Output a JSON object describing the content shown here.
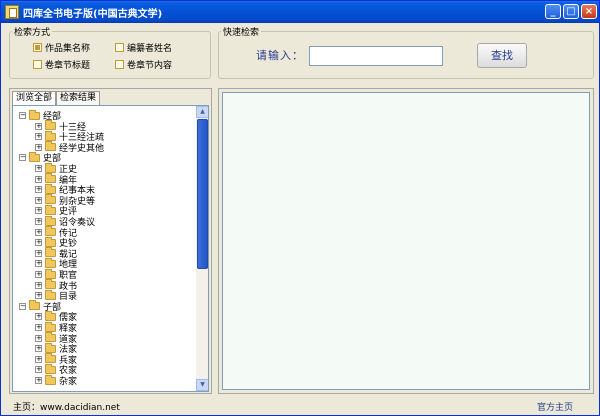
{
  "window": {
    "title": "四库全书电子版(中国古典文学)"
  },
  "search_method": {
    "legend": "检索方式",
    "options": [
      {
        "label": "作品集名称",
        "checked": true
      },
      {
        "label": "编纂者姓名",
        "checked": false
      },
      {
        "label": "卷章节标题",
        "checked": false
      },
      {
        "label": "卷章节内容",
        "checked": false
      }
    ]
  },
  "quick_search": {
    "legend": "快速检索",
    "prompt": "请输入：",
    "input_value": "",
    "button": "查找"
  },
  "tabs": [
    "浏览全部",
    "检索结果"
  ],
  "tree": [
    {
      "label": "经部",
      "level": 0,
      "sign": "−"
    },
    {
      "label": "十三经",
      "level": 1,
      "sign": "+"
    },
    {
      "label": "十三经注疏",
      "level": 1,
      "sign": "+"
    },
    {
      "label": "经学史其他",
      "level": 1,
      "sign": "+"
    },
    {
      "label": "史部",
      "level": 0,
      "sign": "−"
    },
    {
      "label": "正史",
      "level": 1,
      "sign": "+"
    },
    {
      "label": "编年",
      "level": 1,
      "sign": "+"
    },
    {
      "label": "纪事本末",
      "level": 1,
      "sign": "+"
    },
    {
      "label": "别杂史等",
      "level": 1,
      "sign": "+"
    },
    {
      "label": "史评",
      "level": 1,
      "sign": "+"
    },
    {
      "label": "诏令奏议",
      "level": 1,
      "sign": "+"
    },
    {
      "label": "传记",
      "level": 1,
      "sign": "+"
    },
    {
      "label": "史钞",
      "level": 1,
      "sign": "+"
    },
    {
      "label": "载记",
      "level": 1,
      "sign": "+"
    },
    {
      "label": "地理",
      "level": 1,
      "sign": "+"
    },
    {
      "label": "职官",
      "level": 1,
      "sign": "+"
    },
    {
      "label": "政书",
      "level": 1,
      "sign": "+"
    },
    {
      "label": "目录",
      "level": 1,
      "sign": "+"
    },
    {
      "label": "子部",
      "level": 0,
      "sign": "−"
    },
    {
      "label": "儒家",
      "level": 1,
      "sign": "+"
    },
    {
      "label": "释家",
      "level": 1,
      "sign": "+"
    },
    {
      "label": "道家",
      "level": 1,
      "sign": "+"
    },
    {
      "label": "法家",
      "level": 1,
      "sign": "+"
    },
    {
      "label": "兵家",
      "level": 1,
      "sign": "+"
    },
    {
      "label": "农家",
      "level": 1,
      "sign": "+"
    },
    {
      "label": "杂家",
      "level": 1,
      "sign": "+"
    }
  ],
  "footer": {
    "home_label": "主页：",
    "home_url": "www.dacidian.net",
    "official_link": "官方主页"
  },
  "colors": {
    "accent": "#283c8e",
    "title_bar": "#0553d8"
  }
}
